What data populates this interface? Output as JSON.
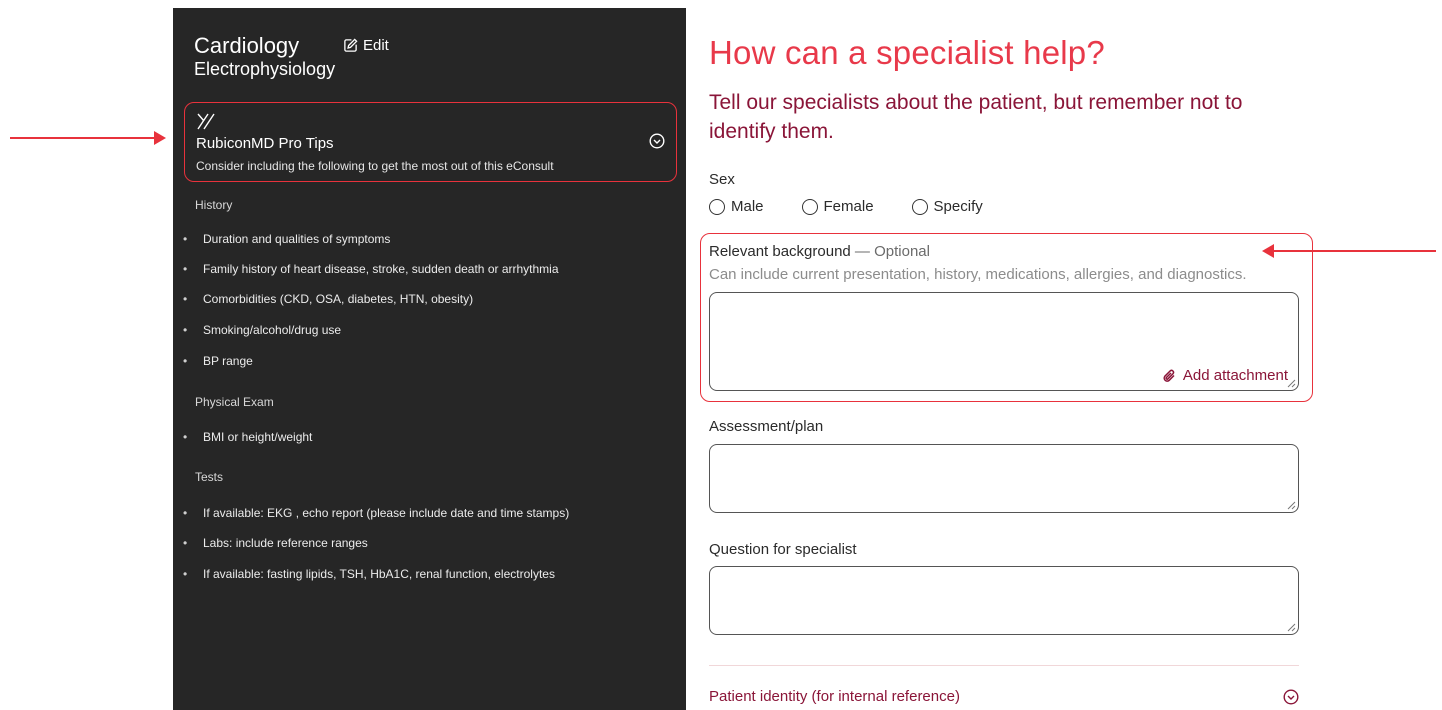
{
  "colors": {
    "annotation_red": "#e8323c",
    "panel_bg": "#262626",
    "heading_red": "#e8394a",
    "maroon": "#8a1538"
  },
  "sidebar": {
    "specialty": "Cardiology",
    "edit_label": "Edit",
    "subspecialty": "Electrophysiology",
    "pro_tips": {
      "logo_icon": "rubiconmd-logo-icon",
      "title": "RubiconMD Pro Tips",
      "subtitle": "Consider including the following to get the most out of this eConsult",
      "toggle_icon": "chevron-down-circle-icon"
    },
    "sections": [
      {
        "heading": "History",
        "items": [
          "Duration and qualities of symptoms",
          "Family history of heart disease, stroke, sudden death or arrhythmia",
          "Comorbidities (CKD, OSA, diabetes, HTN, obesity)",
          "Smoking/alcohol/drug use",
          "BP range"
        ]
      },
      {
        "heading": "Physical Exam",
        "items": [
          "BMI or height/weight"
        ]
      },
      {
        "heading": "Tests",
        "items": [
          "If available: EKG , echo report (please include date and time stamps)",
          "Labs: include reference ranges",
          "If available: fasting lipids, TSH, HbA1C, renal function, electrolytes"
        ]
      }
    ]
  },
  "form": {
    "heading": "How can a specialist help?",
    "subheading": "Tell our specialists about the patient, but remember not to identify them.",
    "sex": {
      "label": "Sex",
      "options": [
        "Male",
        "Female",
        "Specify"
      ]
    },
    "background": {
      "label": "Relevant background",
      "optional": " — Optional",
      "hint": "Can include current presentation, history, medications, allergies, and diagnostics.",
      "value": "",
      "attachment_label": "Add attachment",
      "attachment_icon": "paperclip-icon"
    },
    "assessment": {
      "label": "Assessment/plan",
      "value": ""
    },
    "question": {
      "label": "Question for specialist",
      "value": ""
    },
    "identity": {
      "label": "Patient identity (for internal reference)",
      "toggle_icon": "chevron-down-circle-icon"
    }
  }
}
